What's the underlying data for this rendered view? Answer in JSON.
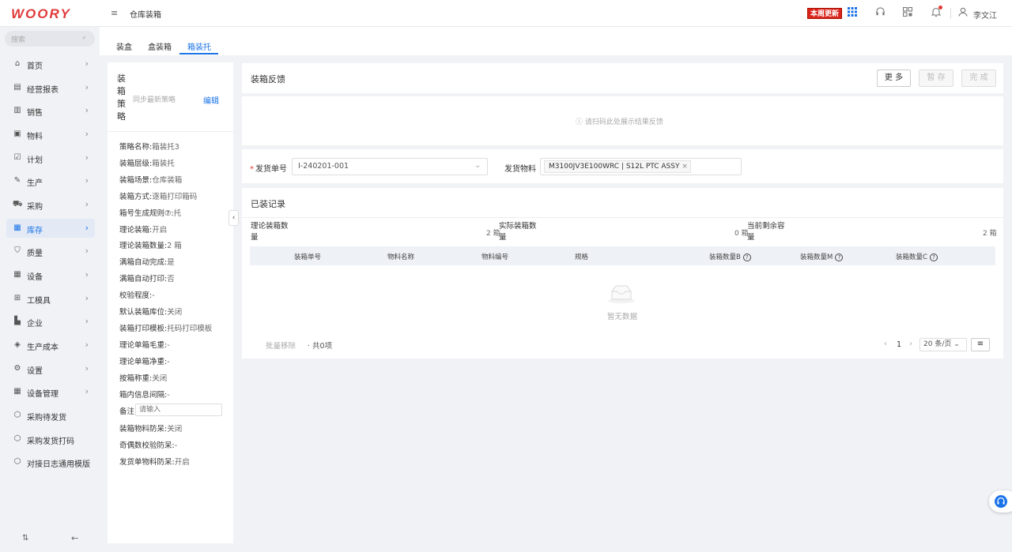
{
  "header": {
    "logo": "WOORY",
    "menu_icon": "≡",
    "page_title": "仓库装箱",
    "update_badge": "本周更新",
    "user_name": "李文江"
  },
  "sidebar": {
    "search_placeholder": "搜索",
    "items": [
      {
        "label": "首页",
        "icon": "home-icon",
        "glyph": "⌂",
        "arrow": "›"
      },
      {
        "label": "经营报表",
        "icon": "report-icon",
        "glyph": "▤",
        "arrow": "›"
      },
      {
        "label": "销售",
        "icon": "sales-icon",
        "glyph": "▥",
        "arrow": "›"
      },
      {
        "label": "物料",
        "icon": "material-icon",
        "glyph": "▣",
        "arrow": "›"
      },
      {
        "label": "计划",
        "icon": "plan-icon",
        "glyph": "☑",
        "arrow": "›"
      },
      {
        "label": "生产",
        "icon": "wrench-icon",
        "glyph": "✎",
        "arrow": "›"
      },
      {
        "label": "采购",
        "icon": "cart-icon",
        "glyph": "⛟",
        "arrow": "›"
      },
      {
        "label": "库存",
        "icon": "warehouse-icon",
        "glyph": "▦",
        "arrow": "›"
      },
      {
        "label": "质量",
        "icon": "shield-icon",
        "glyph": "⛉",
        "arrow": "›"
      },
      {
        "label": "设备",
        "icon": "device-icon",
        "glyph": "▦",
        "arrow": "›"
      },
      {
        "label": "工模具",
        "icon": "toolbox-icon",
        "glyph": "⊞",
        "arrow": "›"
      },
      {
        "label": "企业",
        "icon": "building-icon",
        "glyph": "▙",
        "arrow": "›"
      },
      {
        "label": "生产成本",
        "icon": "cost-icon",
        "glyph": "◈",
        "arrow": "›"
      },
      {
        "label": "设置",
        "icon": "gear-icon",
        "glyph": "⚙",
        "arrow": "›"
      },
      {
        "label": "设备管理",
        "icon": "device-manage-icon",
        "glyph": "▦",
        "arrow": "›"
      },
      {
        "label": "采购待发货",
        "icon": "cube-icon",
        "glyph": "⬡",
        "arrow": ""
      },
      {
        "label": "采购发货打码",
        "icon": "cube-icon",
        "glyph": "⬡",
        "arrow": ""
      },
      {
        "label": "对接日志通用模版",
        "icon": "cube-icon",
        "glyph": "⬡",
        "arrow": ""
      }
    ],
    "active_index": 7,
    "bottom_left": "⇅",
    "bottom_right": "←"
  },
  "tabs": [
    {
      "label": "装盒"
    },
    {
      "label": "盒装箱"
    },
    {
      "label": "箱装托"
    }
  ],
  "strategy": {
    "title": "装箱策略",
    "sync_text": "同步最新策略",
    "edit_label": "编辑",
    "lines": [
      {
        "label": "策略名称:",
        "value": "箱装托3"
      },
      {
        "label": "装箱层级:",
        "value": "箱装托"
      },
      {
        "label": "装箱场景:",
        "value": "仓库装箱"
      },
      {
        "label": "装箱方式:",
        "value": "逐箱打印箱码"
      },
      {
        "label": "箱号生成规则⑦:",
        "value": "托"
      },
      {
        "label": "理论装箱:",
        "value": "开启"
      },
      {
        "label": "理论装箱数量:",
        "value": "2 箱"
      },
      {
        "label": "满箱自动完成:",
        "value": "是"
      },
      {
        "label": "满箱自动打印:",
        "value": "否"
      },
      {
        "label": "校验程度:",
        "value": "-"
      },
      {
        "label": "默认装箱库位:",
        "value": "关闭"
      },
      {
        "label": "装箱打印模板:",
        "value": "托码打印模板"
      },
      {
        "label": "理论单箱毛重:",
        "value": "-"
      },
      {
        "label": "理论单箱净重:",
        "value": "-"
      },
      {
        "label": "按箱称重:",
        "value": "关闭"
      },
      {
        "label": "箱内信息间隔:",
        "value": "-"
      }
    ],
    "note_label": "备注",
    "note_placeholder": "请输入",
    "lines_after": [
      {
        "label": "装箱物料防呆:",
        "value": "关闭"
      },
      {
        "label": "奇偶数校验防呆:",
        "value": "-"
      },
      {
        "label": "发货单物料防呆:",
        "value": "开启"
      }
    ],
    "collapse_icon": "‹"
  },
  "feedback": {
    "title": "装箱反馈",
    "more_label": "更 多",
    "save_label": "暂 存",
    "done_label": "完 成",
    "empty_text": "ⓘ 请扫码此处展示结果反馈"
  },
  "form": {
    "ship_label": "发货单号",
    "ship_required": "*",
    "ship_value": "I-240201-001",
    "ship_arrow": "⌄",
    "material_label": "发货物料",
    "material_tag": "M3100JV3E100WRC | S12L PTC ASSY",
    "material_tag_close": "×"
  },
  "records": {
    "title": "已装记录",
    "stats": [
      {
        "label": "理论装箱数量",
        "value": "2 箱"
      },
      {
        "label": "实际装箱数量",
        "value": "0 箱"
      },
      {
        "label": "当前剩余容量",
        "value": "2 箱"
      }
    ],
    "columns": [
      "装箱单号",
      "物料名称",
      "物料编号",
      "规格",
      "装箱数量B",
      "装箱数量M",
      "装箱数量C"
    ],
    "help_glyph": "?",
    "empty_text": "暂无数据",
    "batch_remove": "批量移除",
    "total": "· 共0项",
    "pager": {
      "prev": "‹",
      "page": "1",
      "next": "›",
      "size": "20 条/页 ⌄",
      "columns_icon": "≡"
    }
  }
}
